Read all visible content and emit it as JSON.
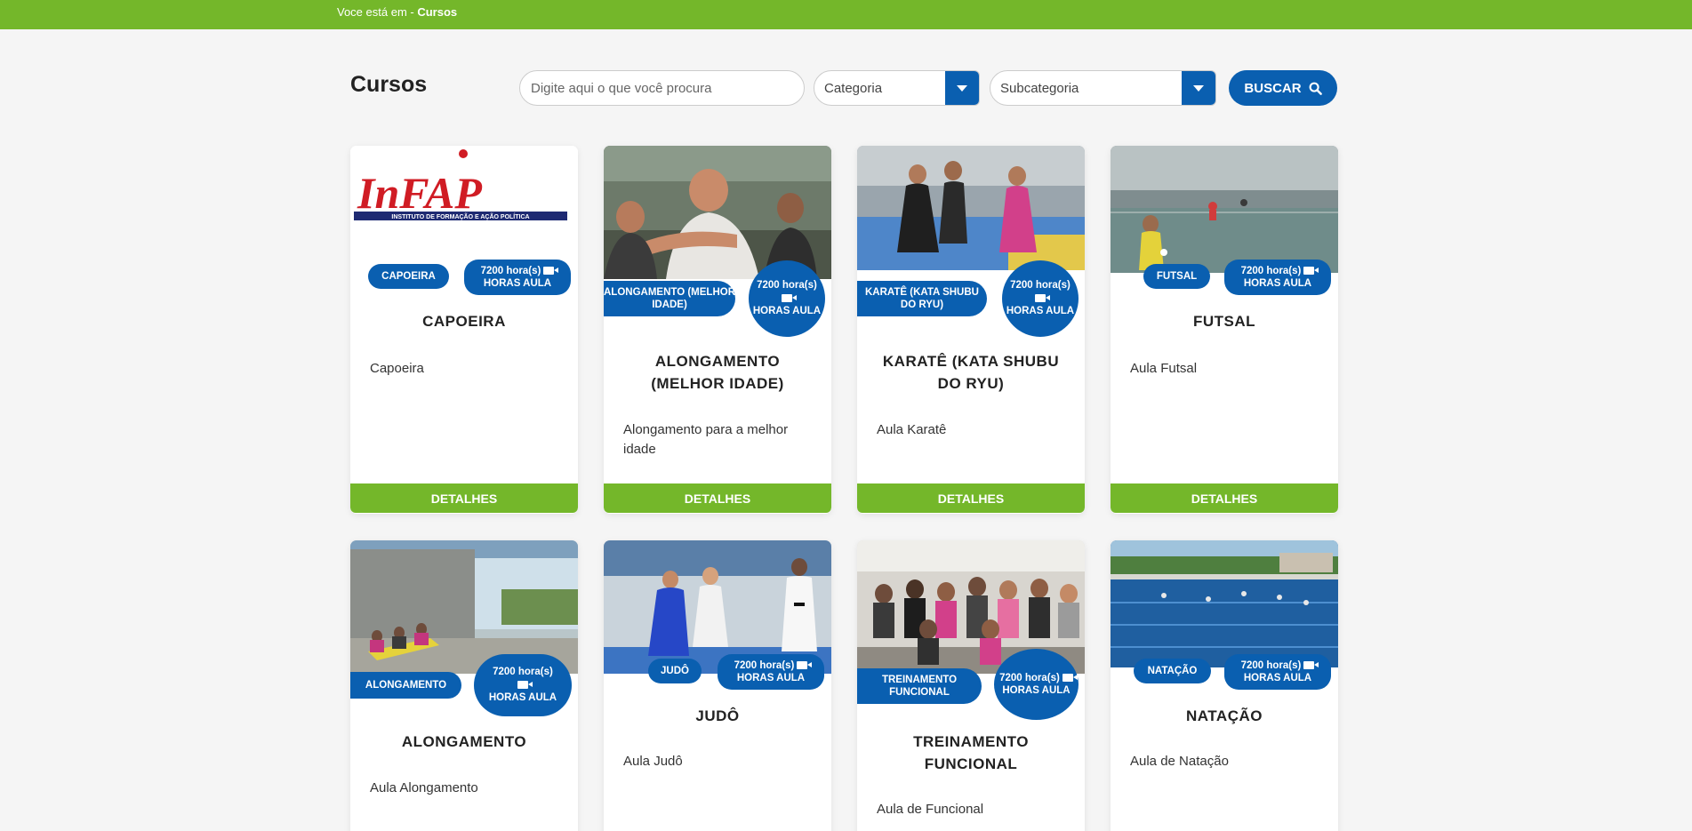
{
  "breadcrumb": {
    "prefix": "Voce está em - ",
    "current": "Cursos"
  },
  "page_title": "Cursos",
  "search": {
    "placeholder": "Digite aqui o que você procura"
  },
  "filters": {
    "category": "Categoria",
    "subcategory": "Subcategoria"
  },
  "buscar_label": "BUSCAR",
  "details_label": "DETALHES",
  "colors": {
    "green": "#74b72a",
    "blue": "#0a5fb0"
  },
  "courses": [
    {
      "category": "CAPOEIRA",
      "hours_line1": "7200 hora(s)",
      "hours_line2": "HORAS AULA",
      "title": "CAPOEIRA",
      "description": "Capoeira",
      "logo_text": "InFAP",
      "logo_subtitle": "INSTITUTO DE FORMAÇÃO E AÇÃO POLÍTICA"
    },
    {
      "category": "ALONGAMENTO (MELHOR IDADE)",
      "hours_line1": "7200 hora(s)",
      "hours_line2": "HORAS AULA",
      "title": "ALONGAMENTO (MELHOR IDADE)",
      "description": "Alongamento para a melhor idade"
    },
    {
      "category": "KARATÊ (KATA SHUBU DO RYU)",
      "hours_line1": "7200 hora(s)",
      "hours_line2": "HORAS AULA",
      "title": "KARATÊ (KATA SHUBU DO RYU)",
      "description": "Aula Karatê"
    },
    {
      "category": "FUTSAL",
      "hours_line1": "7200 hora(s)",
      "hours_line2": "HORAS AULA",
      "title": "FUTSAL",
      "description": "Aula Futsal"
    },
    {
      "category": "ALONGAMENTO",
      "hours_line1": "7200 hora(s)",
      "hours_line2": "HORAS AULA",
      "title": "ALONGAMENTO",
      "description": "Aula Alongamento"
    },
    {
      "category": "JUDÔ",
      "hours_line1": "7200 hora(s)",
      "hours_line2": "HORAS AULA",
      "title": "JUDÔ",
      "description": "Aula Judô"
    },
    {
      "category": "TREINAMENTO FUNCIONAL",
      "hours_line1": "7200 hora(s)",
      "hours_line2": "HORAS AULA",
      "title": "TREINAMENTO FUNCIONAL",
      "description": "Aula de Funcional"
    },
    {
      "category": "NATAÇÃO",
      "hours_line1": "7200 hora(s)",
      "hours_line2": "HORAS AULA",
      "title": "NATAÇÃO",
      "description": "Aula de Natação"
    }
  ]
}
